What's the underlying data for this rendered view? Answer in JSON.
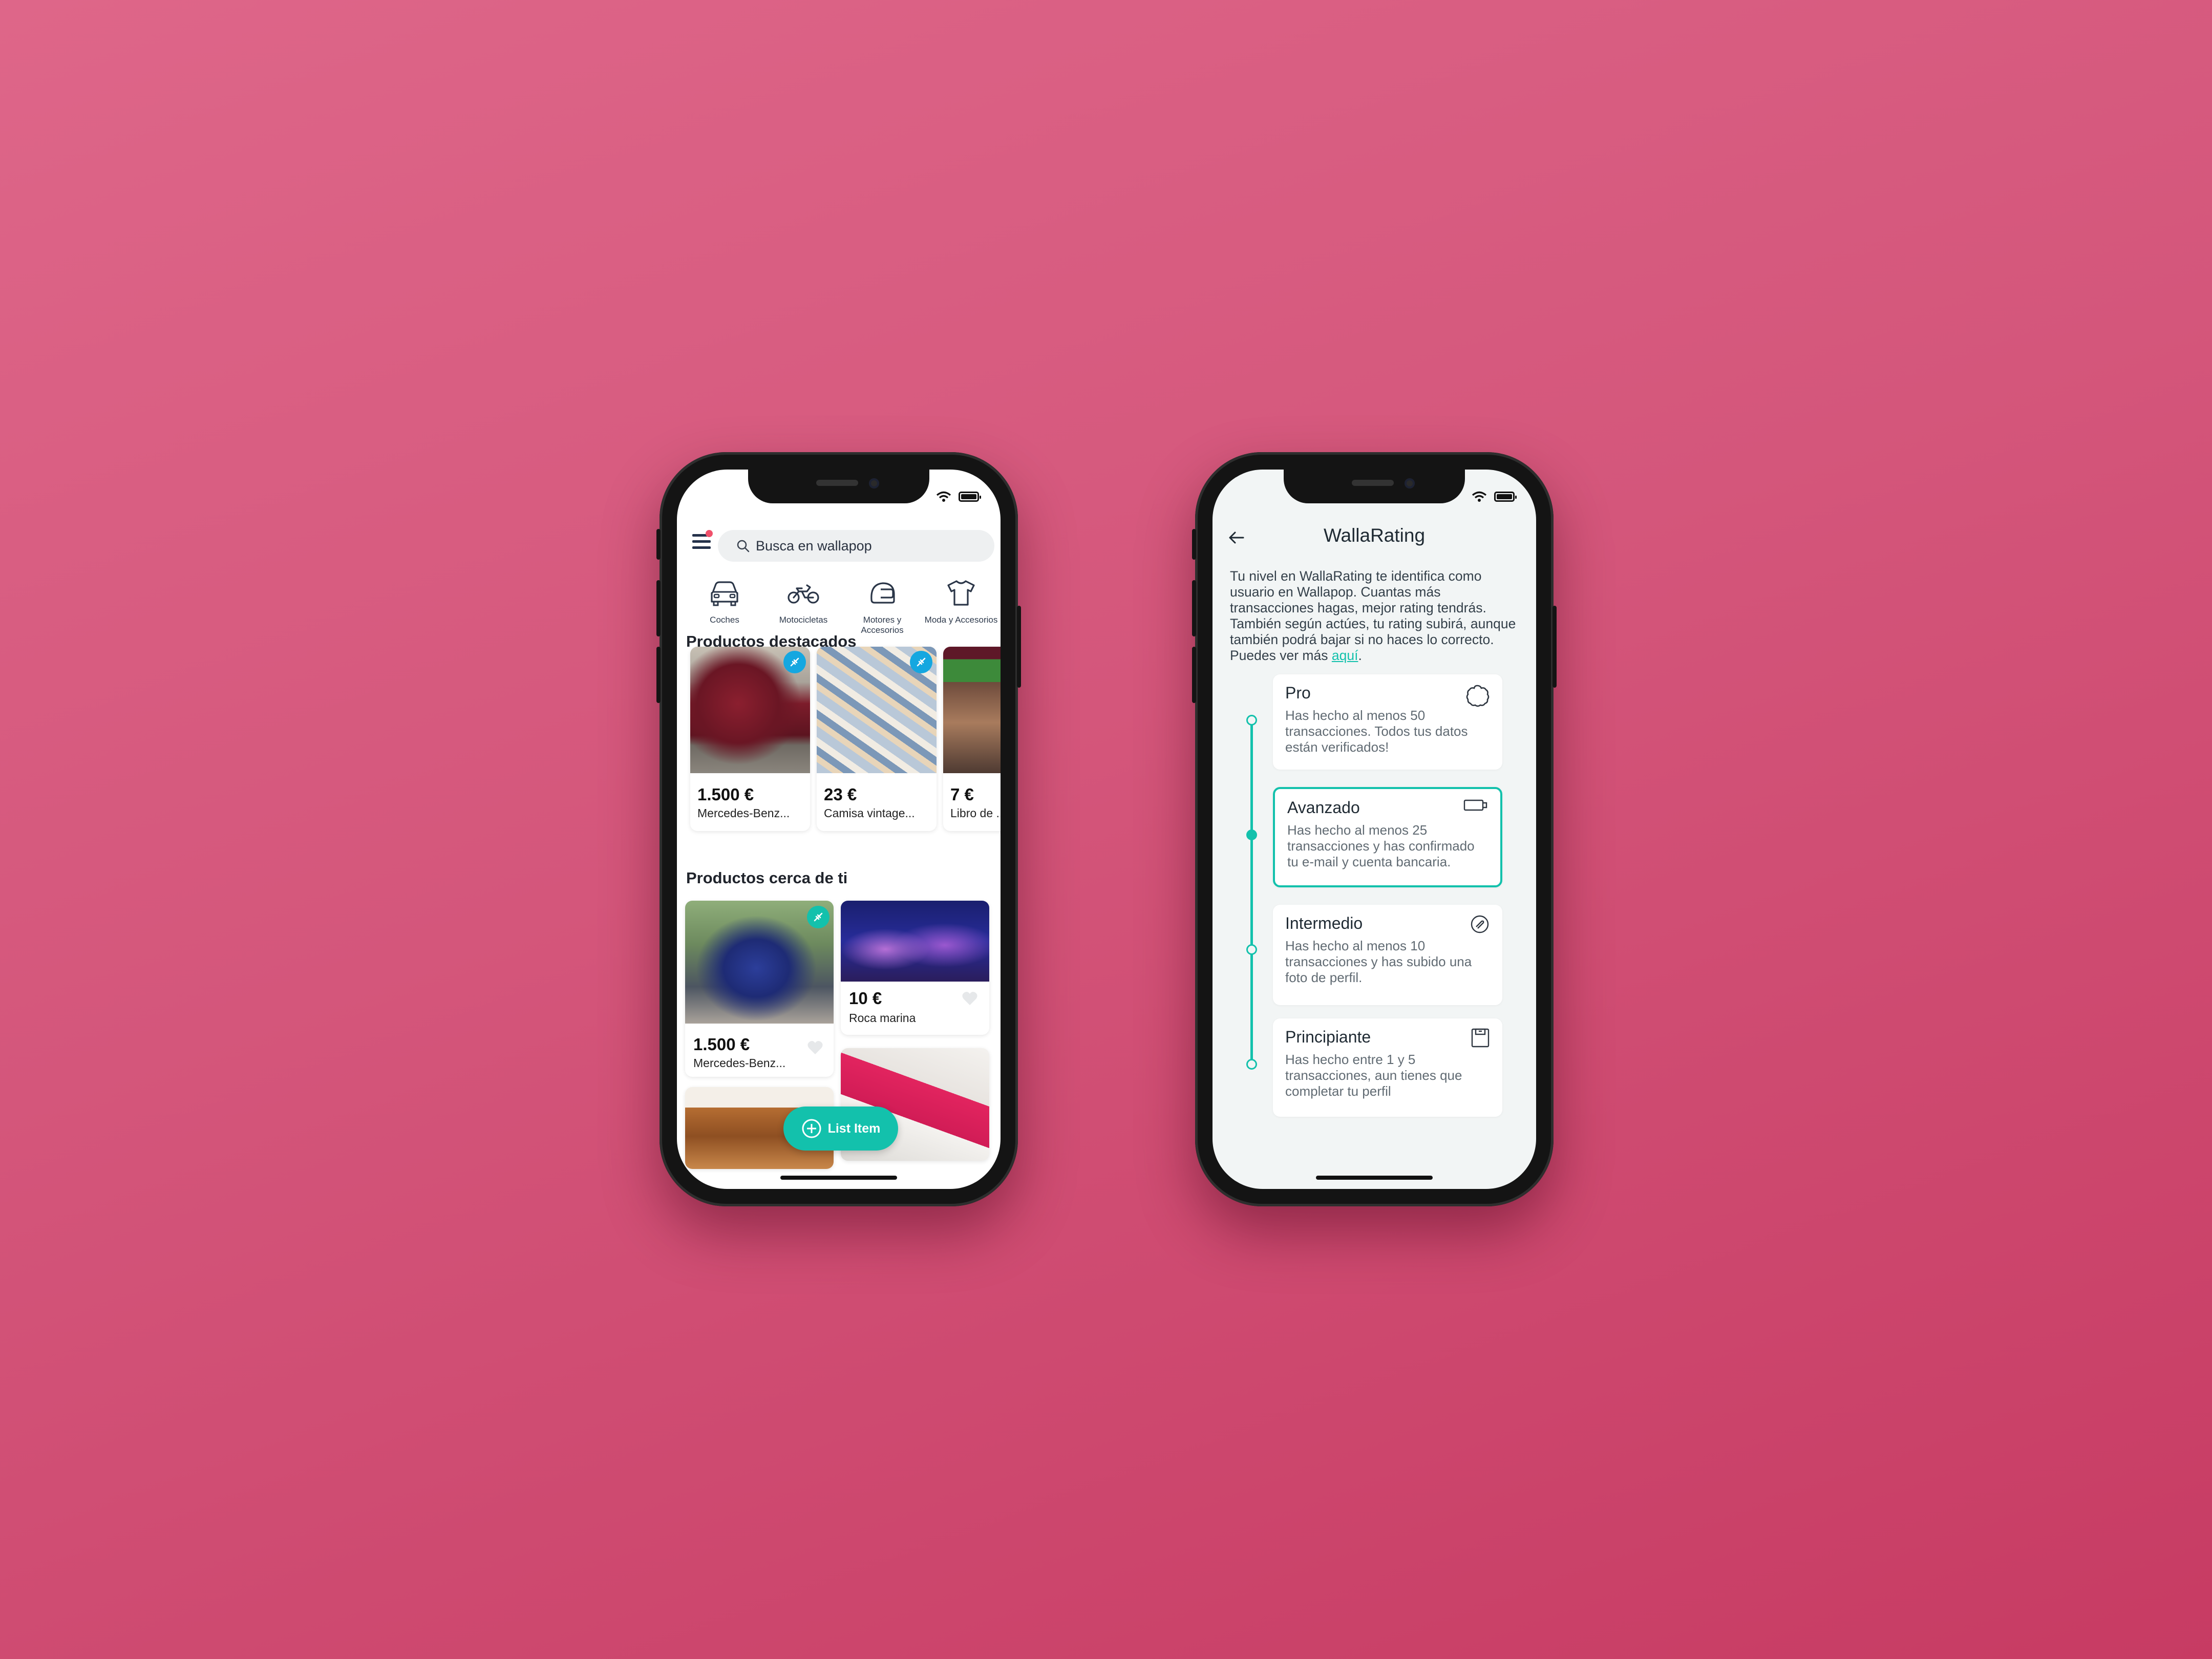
{
  "left_screen": {
    "search": {
      "placeholder": "Busca en wallapop"
    },
    "categories": [
      {
        "label": "Coches",
        "icon": "car-icon"
      },
      {
        "label": "Motocicletas",
        "icon": "motorcycle-icon"
      },
      {
        "label": "Motores y Accesorios",
        "icon": "helmet-icon"
      },
      {
        "label": "Moda y Accesorios",
        "icon": "tshirt-icon"
      }
    ],
    "featured": {
      "title": "Productos destacados",
      "items": [
        {
          "price": "1.500 €",
          "name": "Mercedes-Benz..."
        },
        {
          "price": "23 €",
          "name": "Camisa vintage..."
        },
        {
          "price": "7 €",
          "name": "Libro de ..."
        }
      ]
    },
    "nearby": {
      "title": "Productos cerca de ti",
      "items": [
        {
          "price": "1.500 €",
          "name": "Mercedes-Benz..."
        },
        {
          "price": "10 €",
          "name": "Roca marina"
        }
      ]
    },
    "fab_label": "List Item",
    "accent_color": "#13c1ac"
  },
  "right_screen": {
    "title": "WallaRating",
    "intro": "Tu nivel en WallaRating te identifica como usuario en Wallapop. Cuantas más transacciones hagas, mejor rating tendrás. También según actúes, tu rating subirá, aunque también podrá bajar si no haces lo correcto. Puedes ver más",
    "intro_link": "aquí",
    "levels": [
      {
        "name": "Pro",
        "description": "Has hecho al menos 50 transacciones. Todos tus datos están verificados!",
        "icon": "pro-badge-icon",
        "active": false
      },
      {
        "name": "Avanzado",
        "description": "Has hecho al menos 25 transacciones y has confirmado tu e-mail y cuenta bancaria.",
        "icon": "card-icon",
        "active": true
      },
      {
        "name": "Intermedio",
        "description": "Has hecho al menos 10 transacciones y has subido una foto de perfil.",
        "icon": "photo-icon",
        "active": false
      },
      {
        "name": "Principiante",
        "description": "Has hecho entre 1 y 5 transacciones, aun tienes que completar tu perfil",
        "icon": "profile-icon",
        "active": false
      }
    ]
  }
}
